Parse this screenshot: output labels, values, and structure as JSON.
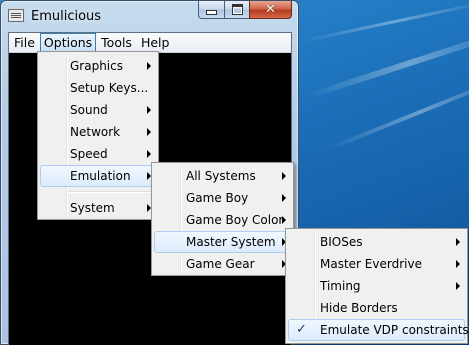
{
  "window": {
    "title": "Emulicious",
    "close_glyph": "✕"
  },
  "menubar": {
    "items": [
      "File",
      "Options",
      "Tools",
      "Help"
    ],
    "active": "Options"
  },
  "options_menu": {
    "items": [
      "Graphics",
      "Setup Keys...",
      "Sound",
      "Network",
      "Speed",
      "Emulation",
      "System"
    ],
    "highlighted": "Emulation"
  },
  "emulation_menu": {
    "items": [
      "All Systems",
      "Game Boy",
      "Game Boy Color",
      "Master System",
      "Game Gear"
    ],
    "highlighted": "Master System"
  },
  "master_system_menu": {
    "items": [
      "BIOSes",
      "Master Everdrive",
      "Timing",
      "Hide Borders",
      "Emulate VDP constraints"
    ],
    "checked": "Emulate VDP constraints",
    "check_glyph": "✓"
  },
  "colors": {
    "menu_bg": "#f0f0f0",
    "highlight_border": "#aeccf0",
    "desktop": "#1b6fb8"
  }
}
